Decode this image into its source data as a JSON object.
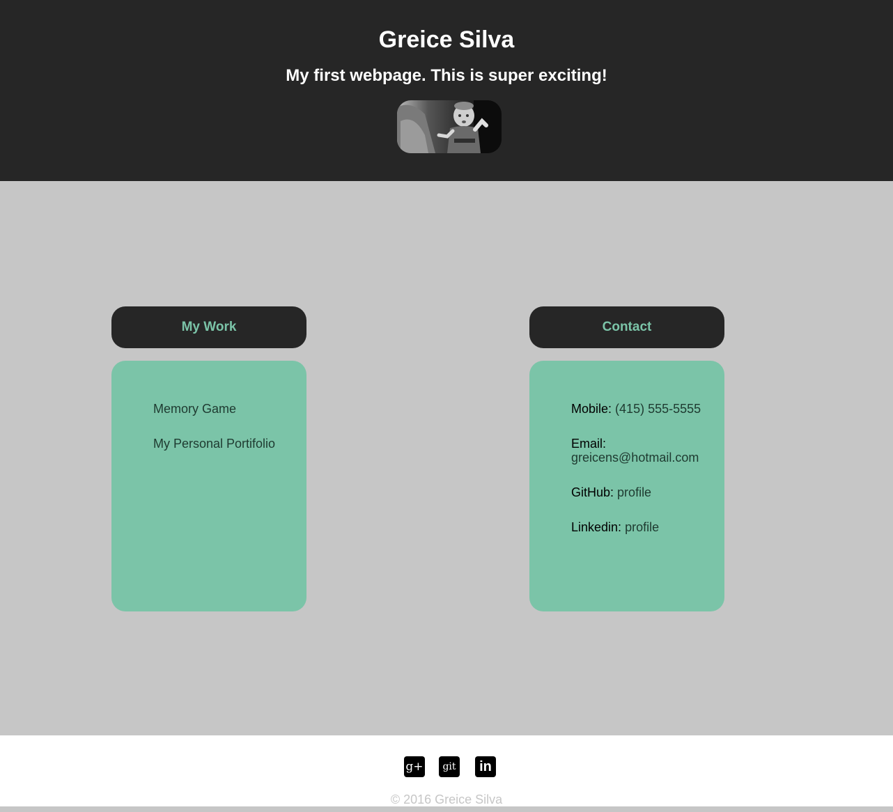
{
  "header": {
    "title": "Greice Silva",
    "subtitle": "My first webpage. This is super exciting!"
  },
  "work": {
    "heading": "My Work",
    "items": [
      "Memory Game",
      "My Personal Portifolio"
    ]
  },
  "contact": {
    "heading": "Contact",
    "items": [
      {
        "label": "Mobile:",
        "value": "(415) 555-5555"
      },
      {
        "label": "Email:",
        "value": "greicens@hotmail.com"
      },
      {
        "label": "GitHub:",
        "value": "profile"
      },
      {
        "label": "Linkedin:",
        "value": "profile"
      }
    ]
  },
  "footer": {
    "social": [
      {
        "icon": "google-plus-icon",
        "glyph": "g+"
      },
      {
        "icon": "github-icon",
        "glyph": "git"
      },
      {
        "icon": "linkedin-icon",
        "glyph": "in"
      }
    ],
    "copyright": "© 2016 Greice Silva"
  },
  "colors": {
    "dark": "#262626",
    "accent": "#7bc4a8",
    "background": "#c6c6c6"
  }
}
